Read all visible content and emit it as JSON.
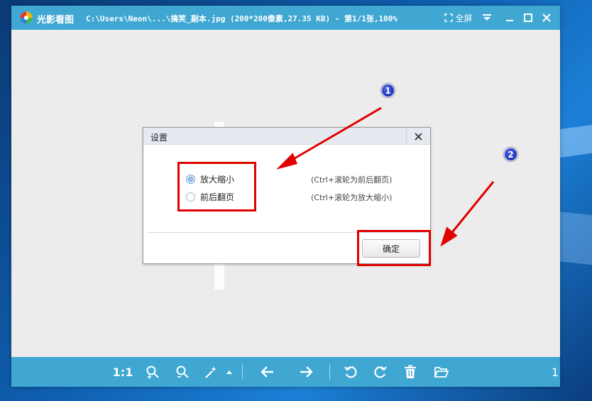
{
  "window": {
    "app_name": "光影看图",
    "file_info": "C:\\Users\\Neon\\...\\搞笑_副本.jpg (200*200像素,27.35 KB) - 第1/1张,100%",
    "fullscreen_label": "全屏"
  },
  "toolbar": {
    "ratio_label": "1:1",
    "counter": "1"
  },
  "dialog": {
    "title": "设置",
    "options": [
      {
        "label": "放大缩小",
        "hint": "(Ctrl+滚轮为前后翻页)",
        "selected": true
      },
      {
        "label": "前后翻页",
        "hint": "(Ctrl+滚轮为放大缩小)",
        "selected": false
      }
    ],
    "ok_label": "确定"
  },
  "annotations": {
    "badges": [
      "1",
      "2"
    ],
    "color": "#e00000"
  },
  "colors": {
    "titlebar": "#3fa7d2",
    "badge": "#1a2fc8"
  }
}
